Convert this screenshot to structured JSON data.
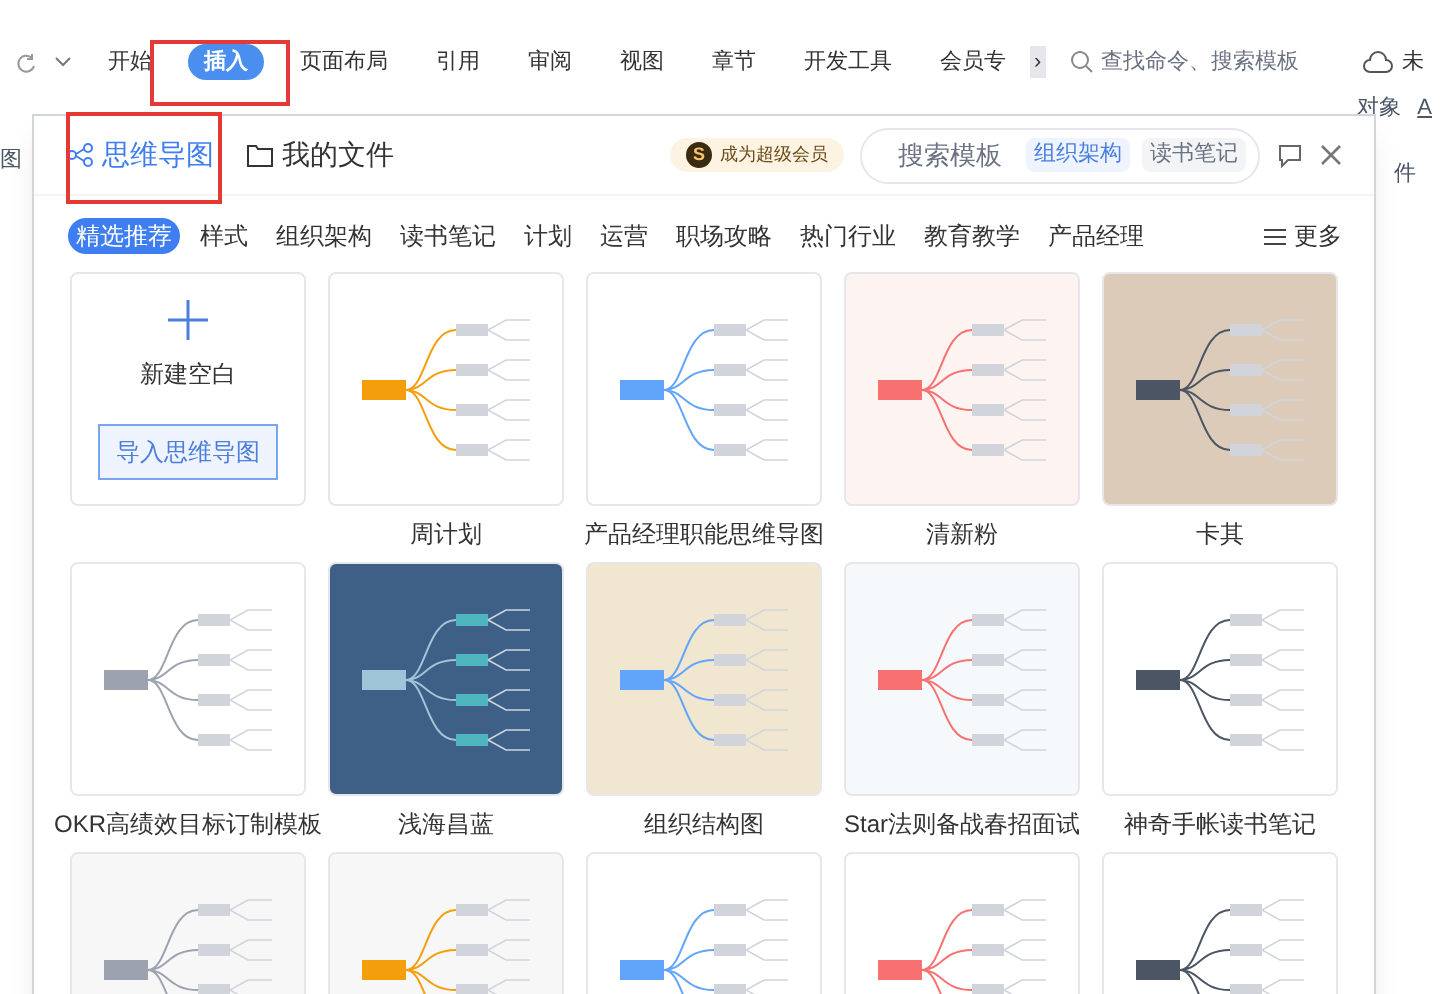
{
  "ribbon": {
    "tabs": [
      {
        "label": "开始",
        "selected": false
      },
      {
        "label": "插入",
        "selected": true
      },
      {
        "label": "页面布局",
        "selected": false
      },
      {
        "label": "引用",
        "selected": false
      },
      {
        "label": "审阅",
        "selected": false
      },
      {
        "label": "视图",
        "selected": false
      },
      {
        "label": "章节",
        "selected": false
      },
      {
        "label": "开发工具",
        "selected": false
      },
      {
        "label": "会员专",
        "selected": false
      }
    ],
    "more": "›",
    "search_placeholder": "查找命令、搜索模板",
    "account": "未",
    "tool_labels": [
      "图",
      "对象",
      "A",
      "件"
    ]
  },
  "dialog": {
    "tabs": [
      {
        "label": "思维导图",
        "selected": true
      },
      {
        "label": "我的文件",
        "selected": false
      }
    ],
    "vip": {
      "icon": "S",
      "label": "成为超级会员"
    },
    "search": {
      "placeholder": "搜索模板",
      "tags": [
        "组织架构",
        "读书笔记"
      ]
    },
    "categories": [
      {
        "label": "精选推荐",
        "selected": true
      },
      {
        "label": "样式",
        "selected": false
      },
      {
        "label": "组织架构",
        "selected": false
      },
      {
        "label": "读书笔记",
        "selected": false
      },
      {
        "label": "计划",
        "selected": false
      },
      {
        "label": "运营",
        "selected": false
      },
      {
        "label": "职场攻略",
        "selected": false
      },
      {
        "label": "热门行业",
        "selected": false
      },
      {
        "label": "教育教学",
        "selected": false
      },
      {
        "label": "产品经理",
        "selected": false
      }
    ],
    "more": "更多",
    "blank": {
      "label": "新建空白",
      "import_button": "导入思维导图"
    },
    "templates": [
      {
        "title": "周计划",
        "color": "#ffffff"
      },
      {
        "title": "产品经理职能思维导图",
        "color": "#ffffff"
      },
      {
        "title": "清新粉",
        "color": "#fdf3f1"
      },
      {
        "title": "卡其",
        "color": "#dccbb8"
      },
      {
        "title": "OKR高绩效目标订制模板",
        "color": "#ffffff"
      },
      {
        "title": "浅海昌蓝",
        "color": "#3e5f86"
      },
      {
        "title": "组织结构图",
        "color": "#f1e6cf"
      },
      {
        "title": "Star法则备战春招面试",
        "color": "#f6f9fc"
      },
      {
        "title": "神奇手帐读书笔记",
        "color": "#ffffff"
      },
      {
        "color": "#f7f7f7"
      },
      {
        "color": "#f7f7f7"
      },
      {
        "color": "#ffffff"
      },
      {
        "color": "#ffffff"
      },
      {
        "color": "#ffffff"
      }
    ]
  }
}
